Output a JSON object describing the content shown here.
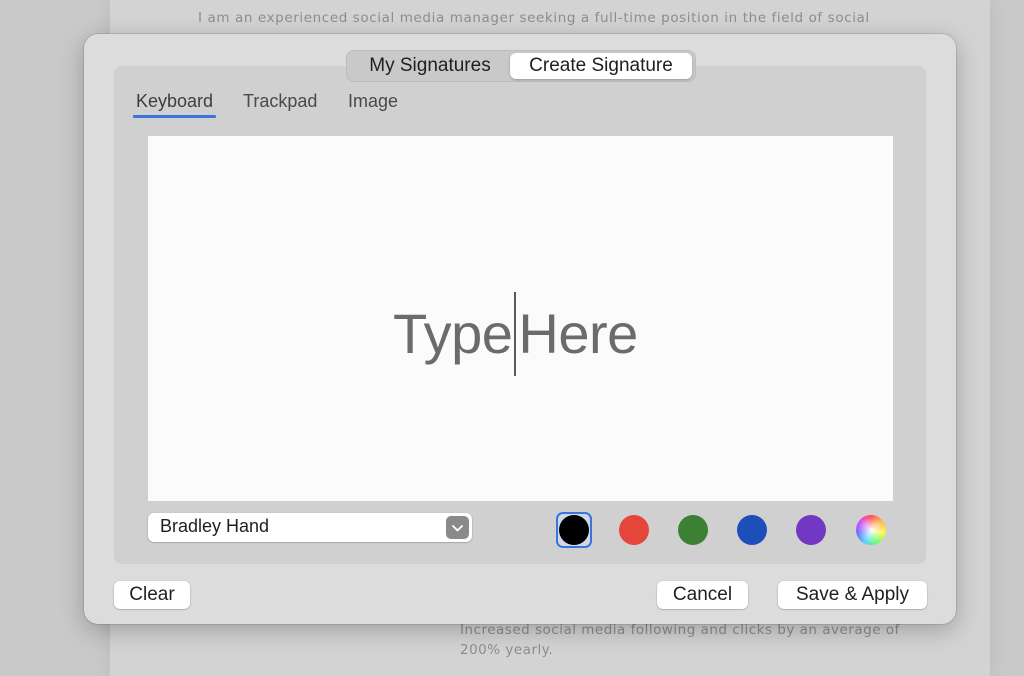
{
  "background_document": {
    "line_top": "I am an experienced social media manager seeking a full-time position in the field of social",
    "line_bottom_1": "Increased social media following and clicks by an average of",
    "line_bottom_2": "200% yearly."
  },
  "dialog": {
    "segments": [
      {
        "label": "My Signatures",
        "selected": false
      },
      {
        "label": "Create Signature",
        "selected": true
      }
    ],
    "tabs": [
      {
        "label": "Keyboard",
        "active": true
      },
      {
        "label": "Trackpad",
        "active": false
      },
      {
        "label": "Image",
        "active": false
      }
    ],
    "canvas": {
      "placeholder_before": "Type",
      "placeholder_after": "Here"
    },
    "font_select": {
      "value": "Bradley Hand",
      "icon": "chevron-down-icon"
    },
    "colors": [
      {
        "name": "black",
        "hex": "#000000",
        "selected": true
      },
      {
        "name": "red",
        "hex": "#e5463c",
        "selected": false
      },
      {
        "name": "green",
        "hex": "#3c8133",
        "selected": false
      },
      {
        "name": "blue",
        "hex": "#1d4fb8",
        "selected": false
      },
      {
        "name": "purple",
        "hex": "#7238c4",
        "selected": false
      },
      {
        "name": "custom",
        "hex": "multicolor",
        "selected": false
      }
    ],
    "buttons": {
      "clear": "Clear",
      "cancel": "Cancel",
      "save": "Save & Apply"
    },
    "accent_color": "#3b74db"
  }
}
